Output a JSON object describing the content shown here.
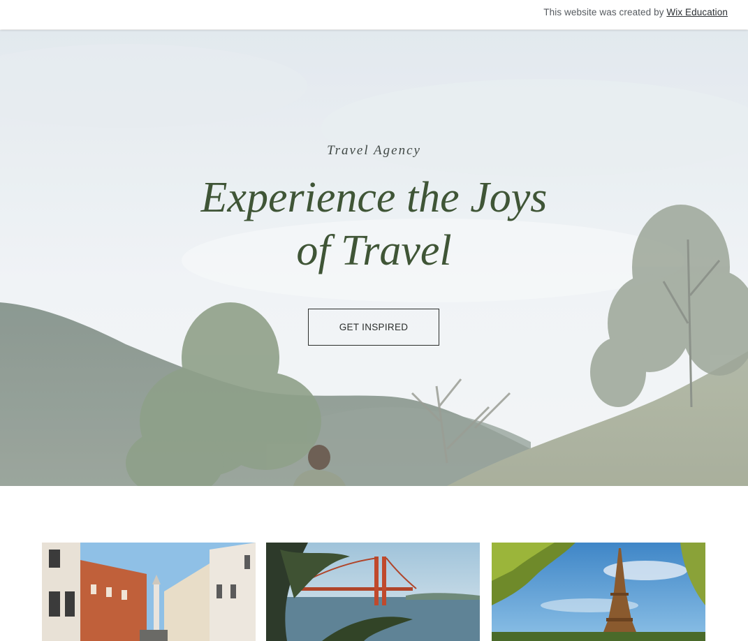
{
  "topbar": {
    "credit_prefix": "This website was created by ",
    "credit_link": "Wix Education"
  },
  "hero": {
    "kicker": "Travel Agency",
    "headline_line1": "Experience the Joys",
    "headline_line2": "of Travel",
    "cta_label": "GET INSPIRED"
  },
  "colors": {
    "headline": "#3f5536",
    "cta_border": "#2b2e2c"
  },
  "gallery": [
    {
      "subject": "venice-canal-street"
    },
    {
      "subject": "golden-gate-bridge"
    },
    {
      "subject": "eiffel-tower"
    }
  ]
}
